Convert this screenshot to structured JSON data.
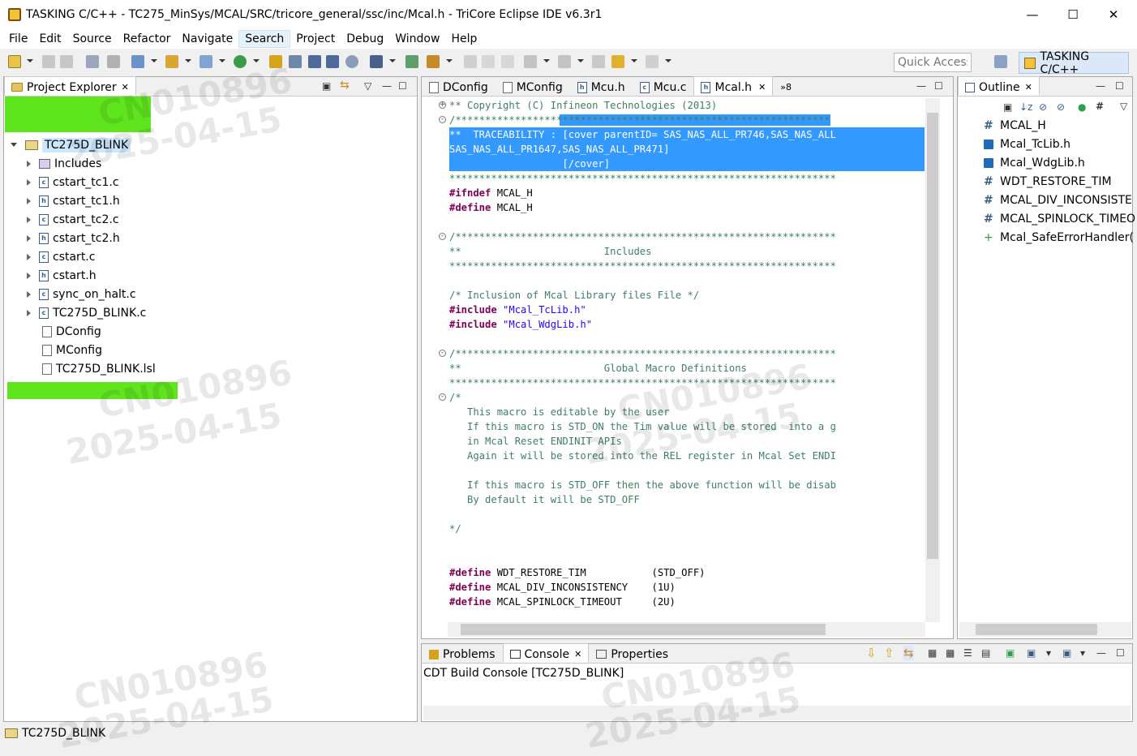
{
  "window": {
    "title": "TASKING C/C++ - TC275_MinSys/MCAL/SRC/tricore_general/ssc/inc/Mcal.h - TriCore Eclipse IDE v6.3r1",
    "controls": {
      "minimize": "—",
      "maximize": "☐",
      "close": "✕"
    }
  },
  "menu": [
    "File",
    "Edit",
    "Source",
    "Refactor",
    "Navigate",
    "Search",
    "Project",
    "Debug",
    "Window",
    "Help"
  ],
  "toolbar": {
    "quick_access_placeholder": "Quick Access",
    "perspective_label": "TASKING C/C++"
  },
  "project_explorer": {
    "title": "Project Explorer",
    "root": "TC275D_BLINK",
    "items": [
      {
        "label": "Includes",
        "icon": "includes-icon",
        "expandable": true
      },
      {
        "label": "cstart_tc1.c",
        "icon": "c-file-icon",
        "expandable": true
      },
      {
        "label": "cstart_tc1.h",
        "icon": "h-file-icon",
        "expandable": true
      },
      {
        "label": "cstart_tc2.c",
        "icon": "c-file-icon",
        "expandable": true
      },
      {
        "label": "cstart_tc2.h",
        "icon": "h-file-icon",
        "expandable": true
      },
      {
        "label": "cstart.c",
        "icon": "c-file-icon",
        "expandable": true
      },
      {
        "label": "cstart.h",
        "icon": "h-file-icon",
        "expandable": true
      },
      {
        "label": "sync_on_halt.c",
        "icon": "c-file-icon",
        "expandable": true
      },
      {
        "label": "TC275D_BLINK.c",
        "icon": "c-file-icon",
        "expandable": true
      },
      {
        "label": "DConfig",
        "icon": "file-icon",
        "expandable": false
      },
      {
        "label": "MConfig",
        "icon": "file-icon",
        "expandable": false
      },
      {
        "label": "TC275D_BLINK.lsl",
        "icon": "file-icon",
        "expandable": false
      }
    ]
  },
  "editor": {
    "tabs": [
      "DConfig",
      "MConfig",
      "Mcu.h",
      "Mcu.c",
      "Mcal.h"
    ],
    "active_tab": "Mcal.h",
    "overflow": "»8",
    "lines": [
      {
        "kind": "cmt",
        "text": "** Copyright (C) Infineon Technologies (2013)"
      },
      {
        "kind": "cmt",
        "text": "/***************************************************************"
      },
      {
        "kind": "sel",
        "text": "**  TRACEABILITY : [cover parentID= SAS_NAS_ALL_PR746,SAS_NAS_ALL"
      },
      {
        "kind": "sel",
        "text": "SAS_NAS_ALL_PR1647,SAS_NAS_ALL_PR471]"
      },
      {
        "kind": "sel",
        "text": "                   [/cover]"
      },
      {
        "kind": "cmt",
        "text": "*****************************************************************"
      },
      {
        "kind": "kw",
        "kw": "#ifndef",
        "text": " MCAL_H"
      },
      {
        "kind": "kw",
        "kw": "#define",
        "text": " MCAL_H"
      },
      {
        "kind": "blank",
        "text": ""
      },
      {
        "kind": "cmt",
        "text": "/****************************************************************"
      },
      {
        "kind": "cmt",
        "text": "**                        Includes"
      },
      {
        "kind": "cmt",
        "text": "*****************************************************************"
      },
      {
        "kind": "blank",
        "text": ""
      },
      {
        "kind": "cmt",
        "text": "/* Inclusion of Mcal Library files File */"
      },
      {
        "kind": "inc",
        "kw": "#include",
        "text": "\"Mcal_TcLib.h\""
      },
      {
        "kind": "inc",
        "kw": "#include",
        "text": "\"Mcal_WdgLib.h\""
      },
      {
        "kind": "blank",
        "text": ""
      },
      {
        "kind": "cmt",
        "text": "/****************************************************************"
      },
      {
        "kind": "cmt",
        "text": "**                        Global Macro Definitions"
      },
      {
        "kind": "cmt",
        "text": "*****************************************************************"
      },
      {
        "kind": "cmt",
        "text": "/*"
      },
      {
        "kind": "cmt",
        "text": "   This macro is editable by the user"
      },
      {
        "kind": "cmt",
        "text": "   If this macro is STD_ON the Tim value will be stored  into a g"
      },
      {
        "kind": "cmt",
        "text": "   in Mcal Reset ENDINIT APIs"
      },
      {
        "kind": "cmt",
        "text": "   Again it will be stored into the REL register in Mcal Set ENDI"
      },
      {
        "kind": "blank",
        "text": ""
      },
      {
        "kind": "cmt",
        "text": "   If this macro is STD_OFF then the above function will be disab"
      },
      {
        "kind": "cmt",
        "text": "   By default it will be STD_OFF"
      },
      {
        "kind": "blank",
        "text": ""
      },
      {
        "kind": "cmt",
        "text": "*/"
      },
      {
        "kind": "blank",
        "text": ""
      },
      {
        "kind": "blank",
        "text": ""
      },
      {
        "kind": "kw",
        "kw": "#define",
        "text": " WDT_RESTORE_TIM           (STD_OFF)"
      },
      {
        "kind": "kw",
        "kw": "#define",
        "text": " MCAL_DIV_INCONSISTENCY    (1U)"
      },
      {
        "kind": "kw",
        "kw": "#define",
        "text": " MCAL_SPINLOCK_TIMEOUT     (2U)"
      }
    ]
  },
  "outline": {
    "title": "Outline",
    "items": [
      {
        "label": "MCAL_H",
        "icon": "macro-icon"
      },
      {
        "label": "Mcal_TcLib.h",
        "icon": "include-icon"
      },
      {
        "label": "Mcal_WdgLib.h",
        "icon": "include-icon"
      },
      {
        "label": "WDT_RESTORE_TIM",
        "icon": "macro-icon"
      },
      {
        "label": "MCAL_DIV_INCONSISTE",
        "icon": "macro-icon"
      },
      {
        "label": "MCAL_SPINLOCK_TIMEO",
        "icon": "macro-icon"
      },
      {
        "label": "Mcal_SafeErrorHandler(",
        "icon": "function-icon"
      }
    ]
  },
  "bottom": {
    "tabs": [
      "Problems",
      "Console",
      "Properties"
    ],
    "active_tab": "Console",
    "console_title": "CDT Build Console [TC275D_BLINK]"
  },
  "status": {
    "selected": "TC275D_BLINK"
  },
  "watermarks": [
    "CN010896",
    "2025-04-15"
  ]
}
